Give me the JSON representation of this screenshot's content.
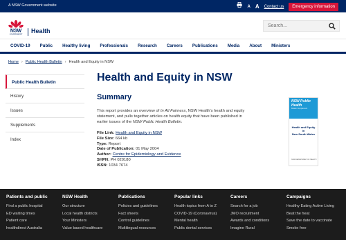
{
  "topbar": {
    "gov_text": "A NSW Government website",
    "print_icon": "printer-icon",
    "font_small": "A",
    "font_large": "A",
    "contact": "Contact us",
    "emergency": "Emergency information"
  },
  "header": {
    "logo_text": "NSW",
    "logo_sub": "GOVERNMENT",
    "section": "Health",
    "search_placeholder": "Search..."
  },
  "nav": [
    "COVID-19",
    "Public",
    "Healthy living",
    "Professionals",
    "Research",
    "Careers",
    "Publications",
    "Media",
    "About",
    "Ministers"
  ],
  "breadcrumb": {
    "items": [
      "Home",
      "Public Health Bulletin",
      "Health and Equity in NSW"
    ]
  },
  "sidebar": {
    "items": [
      "Public Health Bulletin",
      "History",
      "Issues",
      "Supplements",
      "Index"
    ]
  },
  "main": {
    "title": "Health and Equity in NSW",
    "summary_heading": "Summary",
    "desc_1": "This report provides an overview of ",
    "desc_italic_1": "In All Fairness",
    "desc_2": ", NSW Health's health and equity statement, and pulls together articles on health equity that have been published in earlier issues of the ",
    "desc_italic_2": "NSW Public Health Bulletin",
    "desc_3": ".",
    "meta": {
      "file_link_label": "File Link:",
      "file_link": "Health and Equity in NSW",
      "file_size_label": "File Size:",
      "file_size": "664 kb",
      "type_label": "Type:",
      "type": "Report",
      "date_label": "Date of Publication:",
      "date": "01 May 2004",
      "author_label": "Author:",
      "author": "Centre for Epidemiology and Evidence",
      "shpn_label": "SHPN:",
      "shpn": "PH 020180",
      "issn_label": "ISSN:",
      "issn": "1034 7674"
    }
  },
  "cover": {
    "line1": "NSW Public Health",
    "line2": "Bulletin Supplement",
    "title1": "Health and Equity",
    "title2": "in",
    "title3": "New South Wales",
    "foot": "NSW DEPARTMENT OF HEALTH"
  },
  "footer": [
    {
      "heading": "Patients and public",
      "links": [
        "Find a public hospital",
        "ED waiting times",
        "Patient care",
        "healthdirect Australia"
      ]
    },
    {
      "heading": "NSW Health",
      "links": [
        "Our structure",
        "Local health districts",
        "Your Ministers",
        "Value based healthcare"
      ]
    },
    {
      "heading": "Publications",
      "links": [
        "Policies and guidelines",
        "Fact sheets",
        "Control guidelines",
        "Multilingual resources"
      ]
    },
    {
      "heading": "Popular links",
      "links": [
        "Health topics from A to Z",
        "COVID-19 (Coronavirus)",
        "Mental health",
        "Public dental services"
      ]
    },
    {
      "heading": "Careers",
      "links": [
        "Search for a job",
        "JMO recruitment",
        "Awards and conditions",
        "Imagine Rural"
      ]
    },
    {
      "heading": "Campaigns",
      "links": [
        "Healthy Eating Active Living",
        "Beat the heat",
        "Save the date to vaccinate",
        "Smoke free"
      ]
    }
  ],
  "colors": {
    "navy": "#002664",
    "red": "#d7153a",
    "footer_bg": "#1c1c1c"
  }
}
